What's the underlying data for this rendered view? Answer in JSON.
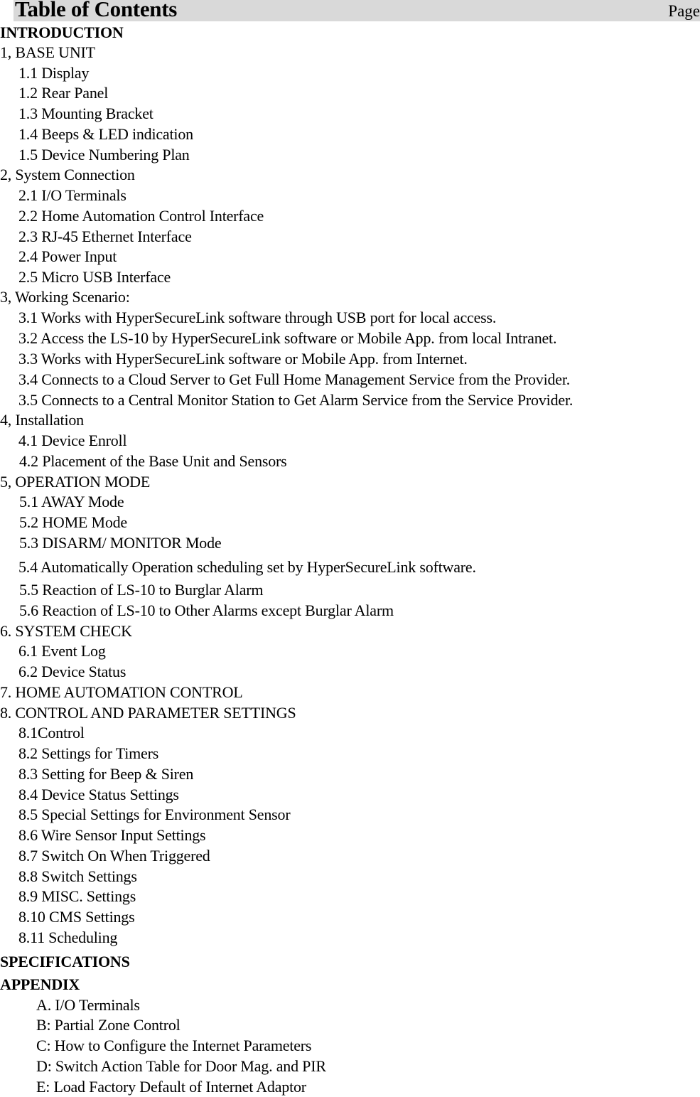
{
  "header": {
    "title": "Table of Contents",
    "page_label": "Page"
  },
  "entries": [
    {
      "text": "INTRODUCTION"
    },
    {
      "text": "1, BASE UNIT"
    },
    {
      "text": "1.1 Display"
    },
    {
      "text": "1.2 Rear Panel"
    },
    {
      "text": "1.3 Mounting Bracket"
    },
    {
      "text": "1.4 Beeps & LED indication"
    },
    {
      "text": "1.5 Device Numbering Plan"
    },
    {
      "text": "2, System Connection"
    },
    {
      "text": "2.1 I/O Terminals"
    },
    {
      "text": "2.2 Home Automation Control Interface"
    },
    {
      "text": "2.3 RJ-45 Ethernet Interface"
    },
    {
      "text": "2.4 Power Input"
    },
    {
      "text": "2.5 Micro USB Interface"
    },
    {
      "text": "3, Working Scenario:"
    },
    {
      "text": "3.1 Works with HyperSecureLink software through USB port for local access."
    },
    {
      "text": "3.2 Access the LS-10 by HyperSecureLink software or Mobile App. from local Intranet."
    },
    {
      "text": "3.3 Works with HyperSecureLink software or Mobile App. from Internet."
    },
    {
      "text": "3.4 Connects to a Cloud Server to Get Full Home Management Service from the Provider."
    },
    {
      "text": "3.5 Connects to a Central Monitor Station to Get Alarm Service from the Service Provider."
    },
    {
      "text": "4, Installation"
    },
    {
      "text": "4.1 Device Enroll"
    },
    {
      "text": "4.2 Placement of the Base Unit and Sensors"
    },
    {
      "text": "5, OPERATION MODE"
    },
    {
      "text": "5.1 AWAY Mode"
    },
    {
      "text": "5.2 HOME Mode"
    },
    {
      "text": "5.3 DISARM/ MONITOR Mode"
    },
    {
      "text": "5.4 Automatically Operation scheduling set by HyperSecureLink software."
    },
    {
      "text": "5.5 Reaction of LS-10 to Burglar Alarm"
    },
    {
      "text": "5.6 Reaction of LS-10 to Other Alarms except Burglar Alarm"
    },
    {
      "text": "6. SYSTEM CHECK"
    },
    {
      "text": "6.1 Event Log"
    },
    {
      "text": "6.2 Device Status"
    },
    {
      "text": "7. HOME AUTOMATION CONTROL"
    },
    {
      "text": "8. CONTROL AND PARAMETER SETTINGS"
    },
    {
      "text": "8.1Control"
    },
    {
      "text": "8.2 Settings for Timers"
    },
    {
      "text": "8.3 Setting for Beep & Siren"
    },
    {
      "text": "8.4 Device Status Settings"
    },
    {
      "text": "8.5 Special Settings for Environment Sensor"
    },
    {
      "text": "8.6 Wire Sensor Input Settings"
    },
    {
      "text": "8.7 Switch On When Triggered"
    },
    {
      "text": "8.8 Switch Settings"
    },
    {
      "text": "8.9 MISC. Settings"
    },
    {
      "text": "8.10 CMS Settings"
    },
    {
      "text": "8.11 Scheduling"
    },
    {
      "text": "SPECIFICATIONS"
    },
    {
      "text": "APPENDIX"
    },
    {
      "text": "A. I/O Terminals"
    },
    {
      "text": "B: Partial Zone Control"
    },
    {
      "text": "C: How to Configure the Internet Parameters"
    },
    {
      "text": "D: Switch Action Table for Door Mag. and PIR"
    },
    {
      "text": "E: Load Factory Default of Internet Adaptor"
    }
  ]
}
